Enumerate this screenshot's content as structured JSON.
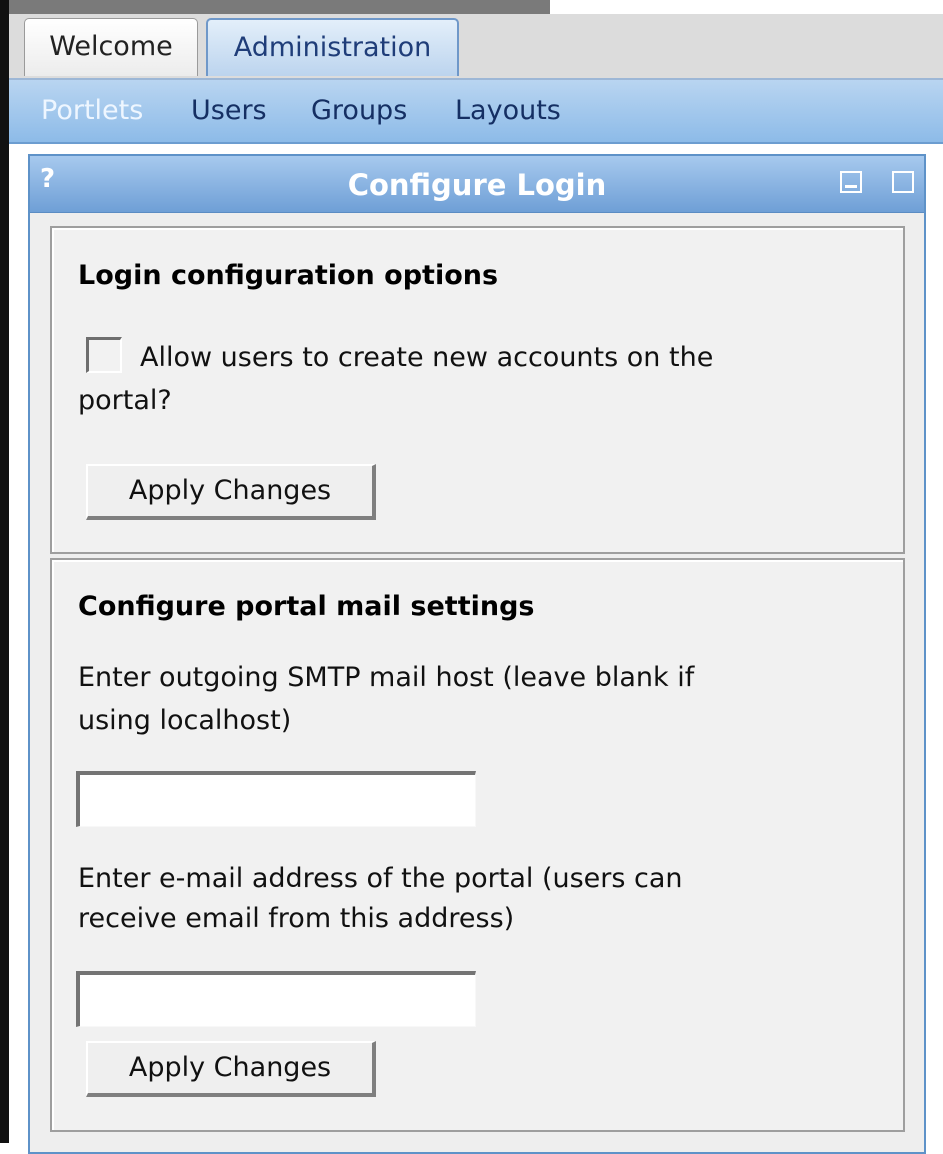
{
  "tabs": [
    {
      "label": "Welcome",
      "active": false
    },
    {
      "label": "Administration",
      "active": true
    }
  ],
  "subnav": [
    {
      "label": "Portlets",
      "active": true
    },
    {
      "label": "Users",
      "active": false
    },
    {
      "label": "Groups",
      "active": false
    },
    {
      "label": "Layouts",
      "active": false
    }
  ],
  "portlet": {
    "help_label": "?",
    "title": "Configure Login",
    "minimize_icon": "minimize-icon",
    "maximize_icon": "maximize-icon"
  },
  "login_section": {
    "heading": "Login configuration options",
    "checkbox_label": "Allow users to create new accounts on the",
    "checkbox_label_cont": "portal?",
    "checkbox_checked": false,
    "apply_label": "Apply Changes"
  },
  "mail_section": {
    "heading": "Configure portal mail settings",
    "smtp_label_line1": "Enter outgoing SMTP mail host (leave blank if",
    "smtp_label_line2": "using localhost)",
    "smtp_value": "",
    "email_label_line1": "Enter e-mail address of the portal (users can",
    "email_label_line2": "receive email from this address)",
    "email_value": "",
    "apply_label": "Apply Changes"
  },
  "colors": {
    "accent_blue": "#6f9fd6",
    "subnav_bg": "#8dbbe8",
    "active_tab_text": "#1f3d79",
    "nav_text": "#152f63",
    "panel_bg": "#eeeeee"
  }
}
